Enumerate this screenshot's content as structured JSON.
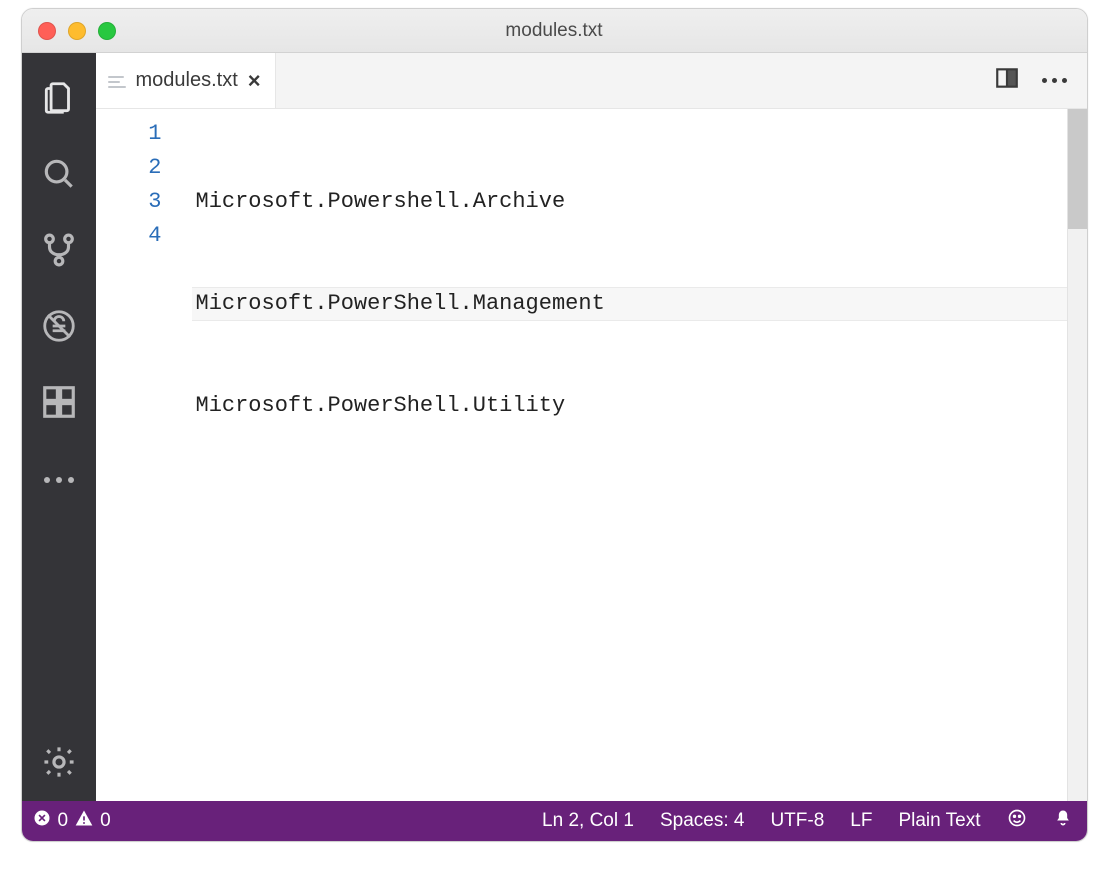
{
  "window": {
    "title": "modules.txt"
  },
  "tab": {
    "label": "modules.txt"
  },
  "activity": {
    "items": [
      {
        "name": "explorer",
        "active": true
      },
      {
        "name": "search",
        "active": false
      },
      {
        "name": "source-control",
        "active": false
      },
      {
        "name": "debug",
        "active": false
      },
      {
        "name": "extensions",
        "active": false
      },
      {
        "name": "more",
        "active": false
      }
    ],
    "bottom": {
      "name": "settings"
    }
  },
  "editor": {
    "lineNumbers": [
      "1",
      "2",
      "3",
      "4"
    ],
    "currentLineIndex": 1,
    "lines": [
      "Microsoft.Powershell.Archive",
      "Microsoft.PowerShell.Management",
      "Microsoft.PowerShell.Utility",
      ""
    ]
  },
  "status": {
    "errors": "0",
    "warnings": "0",
    "cursor": "Ln 2, Col 1",
    "indent": "Spaces: 4",
    "encoding": "UTF-8",
    "eol": "LF",
    "language": "Plain Text"
  },
  "colors": {
    "activityBg": "#343438",
    "statusBg": "#68217a",
    "lineNumber": "#2a6db8"
  }
}
